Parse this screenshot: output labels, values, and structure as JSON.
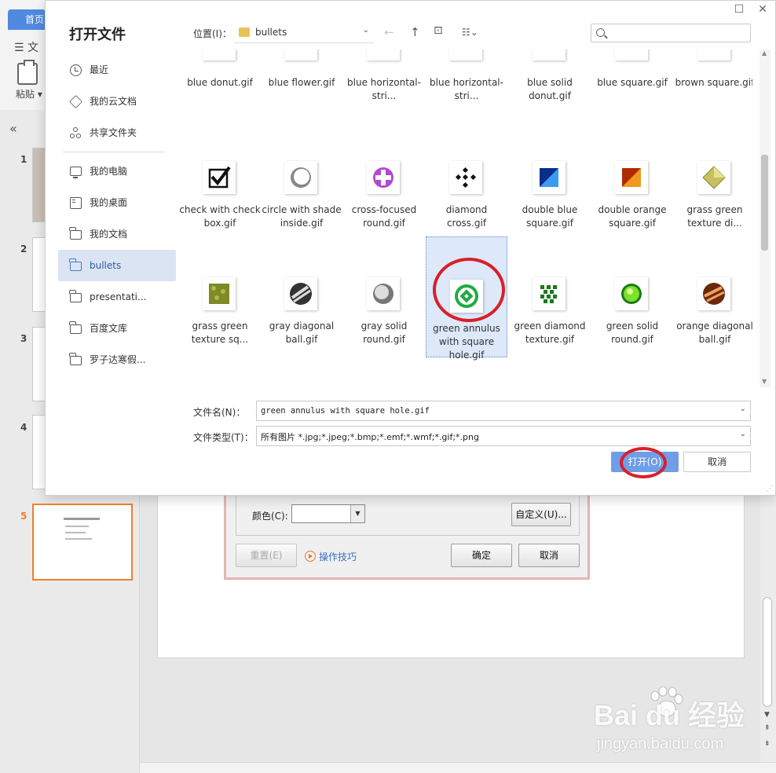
{
  "background": {
    "home_tab": "首页",
    "menu_prefix": "文",
    "paste_label": "粘贴",
    "slides": [
      {
        "num": "1"
      },
      {
        "num": "2"
      },
      {
        "num": "3"
      },
      {
        "num": "4"
      },
      {
        "num": "5"
      }
    ],
    "bullet_dialog": {
      "color_label": "颜色(C):",
      "custom_button": "自定义(U)...",
      "reset_button": "重置(E)",
      "tips_link": "操作技巧",
      "ok_button": "确定",
      "cancel_button": "取消"
    }
  },
  "dialog": {
    "title": "打开文件",
    "location_label": "位置(I)：",
    "location_value": "bullets",
    "nav": [
      {
        "label": "最近",
        "icon": "clock-icon"
      },
      {
        "label": "我的云文档",
        "icon": "cloud-doc-icon"
      },
      {
        "label": "共享文件夹",
        "icon": "share-icon"
      },
      {
        "label": "我的电脑",
        "icon": "computer-icon"
      },
      {
        "label": "我的桌面",
        "icon": "desktop-icon"
      },
      {
        "label": "我的文档",
        "icon": "folder-icon"
      },
      {
        "label": "bullets",
        "icon": "folder-icon",
        "active": true
      },
      {
        "label": "presentati...",
        "icon": "folder-icon"
      },
      {
        "label": "百度文库",
        "icon": "folder-icon"
      },
      {
        "label": "罗子达寒假...",
        "icon": "folder-icon"
      }
    ],
    "files": [
      {
        "name": "blue donut.gif",
        "thumb": "blue-donut"
      },
      {
        "name": "blue flower.gif",
        "thumb": "blue-flower"
      },
      {
        "name": "blue horizontal-stri...",
        "thumb": "blue-hstripe-ball"
      },
      {
        "name": "blue horizontal-stri...",
        "thumb": "blue-hstripe"
      },
      {
        "name": "blue solid donut.gif",
        "thumb": "blue-donut"
      },
      {
        "name": "blue square.gif",
        "thumb": "blue-square"
      },
      {
        "name": "brown square.gif",
        "thumb": "brown-square"
      },
      {
        "name": "check with check box.gif",
        "thumb": "check-box"
      },
      {
        "name": "circle with shade inside.gif",
        "thumb": "shade-circle"
      },
      {
        "name": "cross-focused round.gif",
        "thumb": "cross-round"
      },
      {
        "name": "diamond cross.gif",
        "thumb": "diamond-cross"
      },
      {
        "name": "double blue square.gif",
        "thumb": "double-blue"
      },
      {
        "name": "double orange square.gif",
        "thumb": "double-orange"
      },
      {
        "name": "grass green texture di...",
        "thumb": "grass-diamond"
      },
      {
        "name": "grass green texture sq...",
        "thumb": "grass-square"
      },
      {
        "name": "gray diagonal ball.gif",
        "thumb": "gray-diag-ball"
      },
      {
        "name": "gray solid round.gif",
        "thumb": "gray-round"
      },
      {
        "name": "green annulus with square hole.gif",
        "thumb": "green-annulus",
        "selected": true
      },
      {
        "name": "green diamond texture.gif",
        "thumb": "green-diamond"
      },
      {
        "name": "green solid round.gif",
        "thumb": "green-round"
      },
      {
        "name": "orange diagonal ball.gif",
        "thumb": "orange-ball"
      }
    ],
    "filename_label": "文件名(N)：",
    "filename_value": "green annulus with square hole.gif",
    "filetype_label": "文件类型(T)：",
    "filetype_value": "所有图片 *.jpg;*.jpeg;*.bmp;*.emf;*.wmf;*.gif;*.png",
    "open_button": "打开(O)",
    "cancel_button": "取消"
  },
  "watermark": {
    "brand": "Bai  du 经验",
    "sub": "jingyan.baidu.com"
  },
  "colors": {
    "accent": "#6f9ee8",
    "annotation_red": "#d8202a",
    "slide_active": "#f08030"
  }
}
